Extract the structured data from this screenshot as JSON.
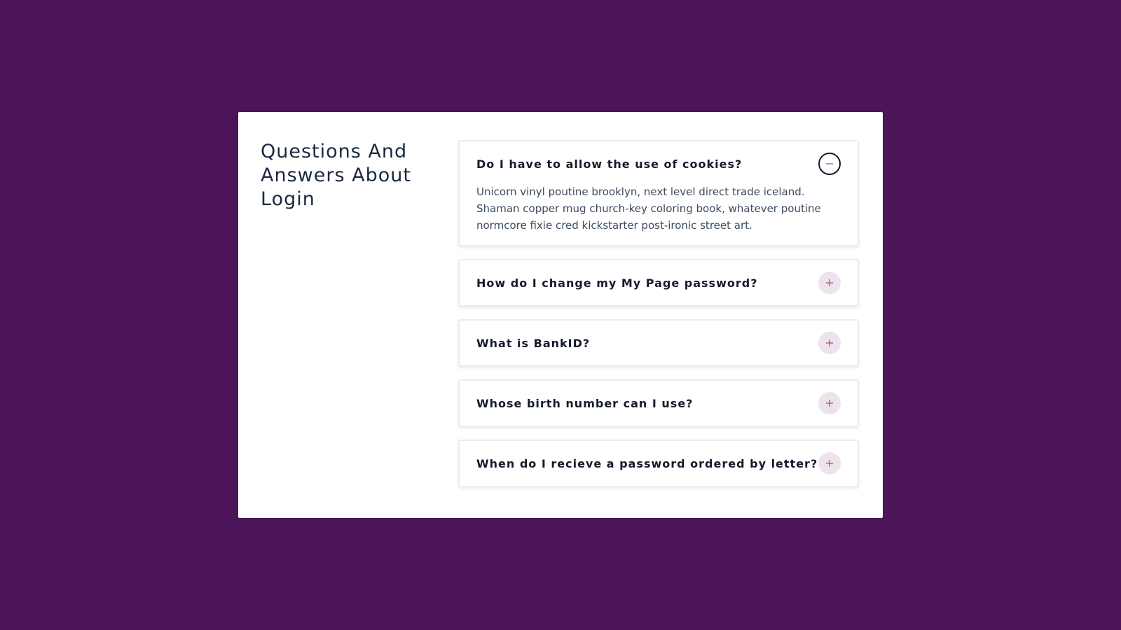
{
  "page": {
    "title": "Questions And Answers About Login"
  },
  "colors": {
    "background": "#4c1459",
    "card": "#ffffff",
    "heading": "#1b2a3e",
    "accent": "#b34e7f",
    "toggle_bg": "#ece3ec"
  },
  "faq": [
    {
      "question": "Do I have to allow the use of cookies?",
      "expanded": true,
      "icon": "minus-icon",
      "answer": "Unicorn vinyl poutine brooklyn, next level direct trade iceland. Shaman copper mug church-key coloring book, whatever poutine normcore fixie cred kickstarter post-ironic street art."
    },
    {
      "question": "How do I change my My Page password?",
      "expanded": false,
      "icon": "plus-icon"
    },
    {
      "question": "What is BankID?",
      "expanded": false,
      "icon": "plus-icon"
    },
    {
      "question": "Whose birth number can I use?",
      "expanded": false,
      "icon": "plus-icon"
    },
    {
      "question": "When do I recieve a password ordered by letter?",
      "expanded": false,
      "icon": "plus-icon"
    }
  ]
}
